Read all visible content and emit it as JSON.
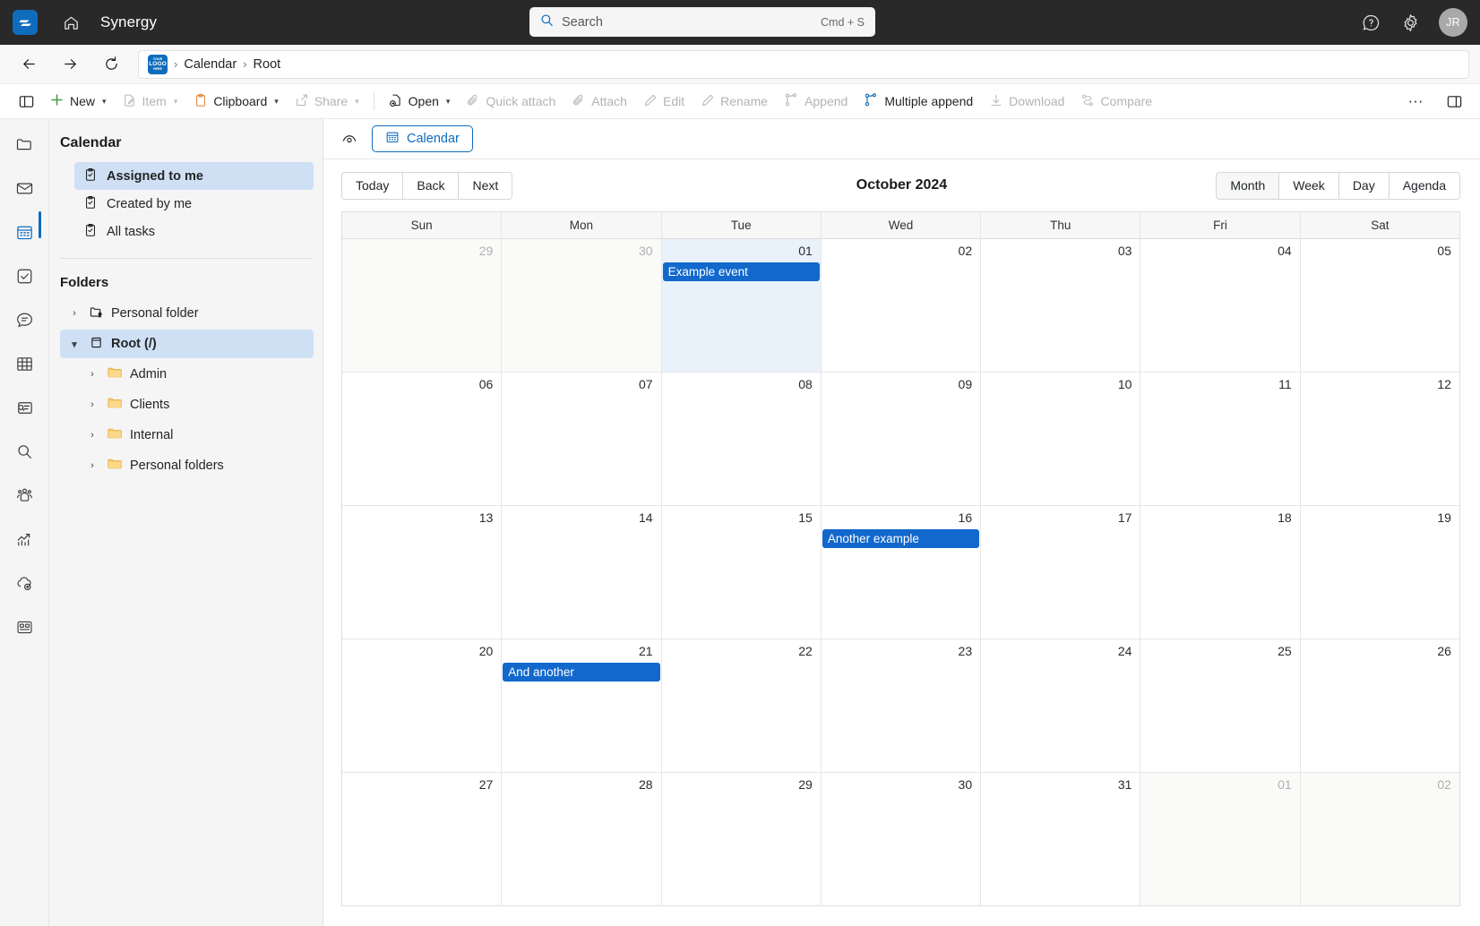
{
  "topbar": {
    "app_title": "Synergy",
    "search_placeholder": "Search",
    "search_value": "",
    "search_hint": "Cmd + S",
    "avatar_initials": "JR",
    "logo_icon": "synergy-logo-icon",
    "home_icon": "home-icon",
    "help_icon": "help-icon",
    "settings_icon": "gear-icon"
  },
  "navbar": {
    "back_icon": "arrow-left-icon",
    "forward_icon": "arrow-right-icon",
    "refresh_icon": "refresh-icon",
    "logo_line1": "YOUR",
    "logo_line2": "LOGO",
    "logo_line3": "HERE",
    "separator": "›",
    "breadcrumb": [
      "Calendar",
      "Root"
    ]
  },
  "commandbar": {
    "panel_toggle_icon": "left-panel-icon",
    "items": [
      {
        "label": "New",
        "icon": "plus-icon",
        "chevron": true,
        "disabled": false
      },
      {
        "label": "Item",
        "icon": "item-edit-icon",
        "chevron": true,
        "disabled": true
      },
      {
        "label": "Clipboard",
        "icon": "clipboard-icon",
        "chevron": true,
        "disabled": false
      },
      {
        "label": "Share",
        "icon": "share-icon",
        "chevron": true,
        "disabled": true
      },
      {
        "label": "Open",
        "icon": "open-file-icon",
        "chevron": true,
        "disabled": false
      },
      {
        "label": "Quick attach",
        "icon": "paperclip-icon",
        "chevron": false,
        "disabled": true
      },
      {
        "label": "Attach",
        "icon": "paperclip-icon",
        "chevron": false,
        "disabled": true
      },
      {
        "label": "Edit",
        "icon": "pencil-icon",
        "chevron": false,
        "disabled": true
      },
      {
        "label": "Rename",
        "icon": "pencil-icon",
        "chevron": false,
        "disabled": true
      },
      {
        "label": "Append",
        "icon": "branch-icon",
        "chevron": false,
        "disabled": true
      },
      {
        "label": "Multiple append",
        "icon": "branch-icon",
        "chevron": false,
        "disabled": false
      },
      {
        "label": "Download",
        "icon": "download-icon",
        "chevron": false,
        "disabled": true
      },
      {
        "label": "Compare",
        "icon": "compare-icon",
        "chevron": false,
        "disabled": true
      }
    ],
    "overflow_label": "···",
    "right_panel_icon": "right-panel-icon"
  },
  "rail": {
    "items": [
      {
        "icon": "folder-icon",
        "active": false
      },
      {
        "icon": "mail-icon",
        "active": false
      },
      {
        "icon": "calendar-icon",
        "active": true
      },
      {
        "icon": "tasks-checkbox-icon",
        "active": false
      },
      {
        "icon": "comment-icon",
        "active": false
      },
      {
        "icon": "table-grid-icon",
        "active": false
      },
      {
        "icon": "search-document-icon",
        "active": false
      },
      {
        "icon": "search-icon",
        "active": false
      },
      {
        "icon": "people-group-icon",
        "active": false
      },
      {
        "icon": "analytics-chart-icon",
        "active": false
      },
      {
        "icon": "cloud-sync-icon",
        "active": false
      },
      {
        "icon": "dashboard-icon",
        "active": false
      }
    ]
  },
  "sidebar": {
    "title": "Calendar",
    "task_items": [
      {
        "label": "Assigned to me",
        "icon": "clipboard-check-icon",
        "selected": true
      },
      {
        "label": "Created by me",
        "icon": "clipboard-check-icon",
        "selected": false
      },
      {
        "label": "All tasks",
        "icon": "clipboard-check-icon",
        "selected": false
      }
    ],
    "folders_title": "Folders",
    "tree": [
      {
        "label": "Personal folder",
        "icon": "personal-folder-icon",
        "twisty": "›",
        "expanded": false,
        "selected": false,
        "indent": false
      },
      {
        "label": "Root (/)",
        "icon": "database-icon",
        "twisty": "˅",
        "expanded": true,
        "selected": true,
        "indent": false
      },
      {
        "label": "Admin",
        "icon": "folder-yellow-icon",
        "twisty": "›",
        "expanded": false,
        "selected": false,
        "indent": true
      },
      {
        "label": "Clients",
        "icon": "folder-yellow-icon",
        "twisty": "›",
        "expanded": false,
        "selected": false,
        "indent": true
      },
      {
        "label": "Internal",
        "icon": "folder-yellow-icon",
        "twisty": "›",
        "expanded": false,
        "selected": false,
        "indent": true
      },
      {
        "label": "Personal folders",
        "icon": "folder-yellow-icon",
        "twisty": "›",
        "expanded": false,
        "selected": false,
        "indent": true
      }
    ]
  },
  "main": {
    "eye_icon": "eye-icon",
    "tab_label": "Calendar",
    "tab_icon": "calendar-icon",
    "nav_buttons": [
      "Today",
      "Back",
      "Next"
    ],
    "title": "October 2024",
    "view_buttons": [
      {
        "label": "Month",
        "active": true
      },
      {
        "label": "Week",
        "active": false
      },
      {
        "label": "Day",
        "active": false
      },
      {
        "label": "Agenda",
        "active": false
      }
    ]
  },
  "calendar_data": {
    "type": "table",
    "month": "October 2024",
    "weekday_headers": [
      "Sun",
      "Mon",
      "Tue",
      "Wed",
      "Thu",
      "Fri",
      "Sat"
    ],
    "weeks": [
      [
        {
          "day": "29",
          "other_month": true,
          "today": false,
          "events": []
        },
        {
          "day": "30",
          "other_month": true,
          "today": false,
          "events": []
        },
        {
          "day": "01",
          "other_month": false,
          "today": true,
          "events": [
            "Example event"
          ]
        },
        {
          "day": "02",
          "other_month": false,
          "today": false,
          "events": []
        },
        {
          "day": "03",
          "other_month": false,
          "today": false,
          "events": []
        },
        {
          "day": "04",
          "other_month": false,
          "today": false,
          "events": []
        },
        {
          "day": "05",
          "other_month": false,
          "today": false,
          "events": []
        }
      ],
      [
        {
          "day": "06",
          "other_month": false,
          "today": false,
          "events": []
        },
        {
          "day": "07",
          "other_month": false,
          "today": false,
          "events": []
        },
        {
          "day": "08",
          "other_month": false,
          "today": false,
          "events": []
        },
        {
          "day": "09",
          "other_month": false,
          "today": false,
          "events": []
        },
        {
          "day": "10",
          "other_month": false,
          "today": false,
          "events": []
        },
        {
          "day": "11",
          "other_month": false,
          "today": false,
          "events": []
        },
        {
          "day": "12",
          "other_month": false,
          "today": false,
          "events": []
        }
      ],
      [
        {
          "day": "13",
          "other_month": false,
          "today": false,
          "events": []
        },
        {
          "day": "14",
          "other_month": false,
          "today": false,
          "events": []
        },
        {
          "day": "15",
          "other_month": false,
          "today": false,
          "events": []
        },
        {
          "day": "16",
          "other_month": false,
          "today": false,
          "events": [
            "Another example"
          ]
        },
        {
          "day": "17",
          "other_month": false,
          "today": false,
          "events": []
        },
        {
          "day": "18",
          "other_month": false,
          "today": false,
          "events": []
        },
        {
          "day": "19",
          "other_month": false,
          "today": false,
          "events": []
        }
      ],
      [
        {
          "day": "20",
          "other_month": false,
          "today": false,
          "events": []
        },
        {
          "day": "21",
          "other_month": false,
          "today": false,
          "events": [
            "And another"
          ]
        },
        {
          "day": "22",
          "other_month": false,
          "today": false,
          "events": []
        },
        {
          "day": "23",
          "other_month": false,
          "today": false,
          "events": []
        },
        {
          "day": "24",
          "other_month": false,
          "today": false,
          "events": []
        },
        {
          "day": "25",
          "other_month": false,
          "today": false,
          "events": []
        },
        {
          "day": "26",
          "other_month": false,
          "today": false,
          "events": []
        }
      ],
      [
        {
          "day": "27",
          "other_month": false,
          "today": false,
          "events": []
        },
        {
          "day": "28",
          "other_month": false,
          "today": false,
          "events": []
        },
        {
          "day": "29",
          "other_month": false,
          "today": false,
          "events": []
        },
        {
          "day": "30",
          "other_month": false,
          "today": false,
          "events": []
        },
        {
          "day": "31",
          "other_month": false,
          "today": false,
          "events": []
        },
        {
          "day": "01",
          "other_month": true,
          "today": false,
          "events": []
        },
        {
          "day": "02",
          "other_month": true,
          "today": false,
          "events": []
        }
      ]
    ]
  },
  "colors": {
    "accent": "#0f6cbd",
    "event": "#1268cc",
    "selection": "#cfe0f5",
    "today_cell": "#e9f2fb",
    "topbar_bg": "#292929"
  }
}
